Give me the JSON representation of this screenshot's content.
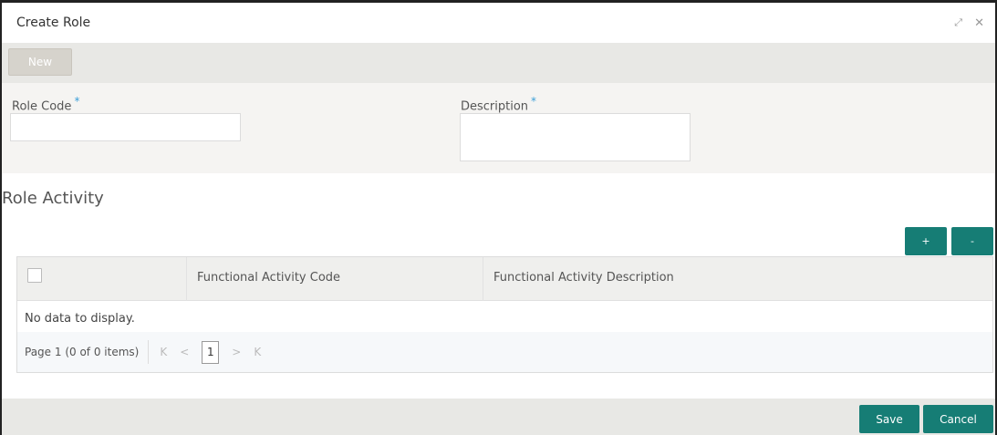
{
  "window": {
    "title": "Create Role",
    "icons": [
      "expand-icon",
      "close-icon"
    ],
    "expand_glyph": "⤢",
    "close_glyph": "✕"
  },
  "toolbar": {
    "new_label": "New"
  },
  "form": {
    "role_code": {
      "label": "Role Code",
      "required": "*",
      "value": ""
    },
    "description": {
      "label": "Description",
      "required": "*",
      "value": ""
    }
  },
  "role_activity": {
    "title": "Role Activity",
    "add_label": "+",
    "remove_label": "-",
    "columns": [
      "Functional Activity Code",
      "Functional Activity Description"
    ],
    "empty_message": "No data to display.",
    "pager": {
      "text": "Page  1  (0 of 0 items)",
      "first": "K",
      "prev": "<",
      "page": "1",
      "next": ">",
      "last": "K"
    }
  },
  "footer": {
    "save_label": "Save",
    "cancel_label": "Cancel"
  },
  "colors": {
    "accent": "#167d75",
    "required": "#3da0d8",
    "toolbar_bg": "#e8e8e5"
  }
}
